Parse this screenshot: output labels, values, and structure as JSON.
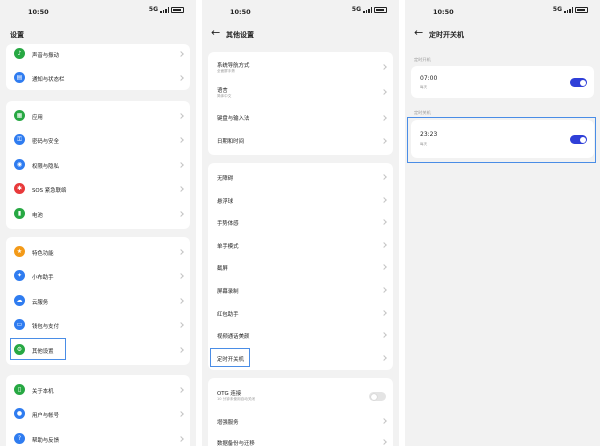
{
  "status_bar": {
    "time": "10:50",
    "network": "5G",
    "signal": "5ıll"
  },
  "screen1": {
    "title": "设置",
    "groups": [
      [
        {
          "label": "声音与振动",
          "icon": "sound-icon",
          "color": "#27a843",
          "glyph": "♪"
        },
        {
          "label": "通知与状态栏",
          "icon": "notification-icon",
          "color": "#2f7cf0",
          "glyph": "▤"
        }
      ],
      [
        {
          "label": "应用",
          "icon": "apps-icon",
          "color": "#27a843",
          "glyph": "▦"
        },
        {
          "label": "密码与安全",
          "icon": "key-icon",
          "color": "#2f7cf0",
          "glyph": "⚿"
        },
        {
          "label": "权限与隐私",
          "icon": "privacy-icon",
          "color": "#2f7cf0",
          "glyph": "◉"
        },
        {
          "label": "SOS 紧急联络",
          "icon": "sos-icon",
          "color": "#e8393a",
          "glyph": "✱"
        },
        {
          "label": "电池",
          "icon": "battery-icon",
          "color": "#27a843",
          "glyph": "▮"
        }
      ],
      [
        {
          "label": "特色功能",
          "icon": "star-icon",
          "color": "#f39a18",
          "glyph": "★"
        },
        {
          "label": "小布助手",
          "icon": "assistant-icon",
          "color": "#2f7cf0",
          "glyph": "✦"
        },
        {
          "label": "云服务",
          "icon": "cloud-icon",
          "color": "#2f7cf0",
          "glyph": "☁"
        },
        {
          "label": "钱包与支付",
          "icon": "wallet-icon",
          "color": "#2f7cf0",
          "glyph": "▭"
        },
        {
          "label": "其他设置",
          "icon": "gear-icon",
          "color": "#27a843",
          "glyph": "⚙"
        }
      ],
      [
        {
          "label": "关于本机",
          "icon": "phone-icon",
          "color": "#27a843",
          "glyph": "▯"
        },
        {
          "label": "用户与帐号",
          "icon": "user-icon",
          "color": "#2f7cf0",
          "glyph": "●"
        },
        {
          "label": "帮助与反馈",
          "icon": "help-icon",
          "color": "#2f7cf0",
          "glyph": "?"
        }
      ]
    ]
  },
  "screen2": {
    "title": "其他设置",
    "card1": [
      {
        "label": "系统导航方式",
        "sub": "全面屏手势"
      },
      {
        "label": "语言",
        "sub": "简体中文"
      },
      {
        "label": "键盘与输入法"
      },
      {
        "label": "日期和时间"
      }
    ],
    "card2": [
      "无障碍",
      "悬浮球",
      "手势体感",
      "单手模式",
      "截屏",
      "屏幕录制",
      "红包助手",
      "视频通话美颜",
      "定时开关机"
    ],
    "card3": [
      {
        "label": "OTG 连接",
        "sub": "10 分钟未使用自动关闭",
        "toggle": "off"
      },
      {
        "label": "增强服务"
      },
      {
        "label": "数据备份与迁移"
      }
    ]
  },
  "screen3": {
    "title": "定时开关机",
    "on_section": "定时开机",
    "on_time": "07:00",
    "on_repeat": "每天",
    "off_section": "定时关机",
    "off_time": "23:23",
    "off_repeat": "每天"
  }
}
